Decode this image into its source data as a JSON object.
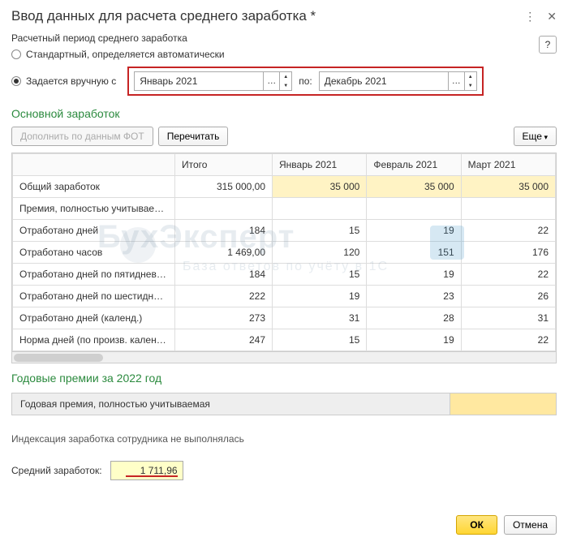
{
  "window": {
    "title": "Ввод данных для расчета среднего заработка *"
  },
  "period": {
    "section_label": "Расчетный период среднего заработка",
    "radio_auto": "Стандартный, определяется автоматически",
    "radio_manual": "Задается вручную  с",
    "from": "Январь 2021",
    "to_label": "по:",
    "to": "Декабрь 2021"
  },
  "earnings": {
    "heading": "Основной заработок",
    "btn_add": "Дополнить по данным ФОТ",
    "btn_recalc": "Перечитать",
    "btn_more": "Еще"
  },
  "table": {
    "headers": [
      "",
      "Итого",
      "Январь 2021",
      "Февраль 2021",
      "Март 2021"
    ],
    "rows": [
      {
        "label": "Общий заработок",
        "total": "315 000,00",
        "m1": "35 000",
        "m2": "35 000",
        "m3": "35 000",
        "yellow": true
      },
      {
        "label": "Премия, полностью учитываемая",
        "total": "",
        "m1": "",
        "m2": "",
        "m3": ""
      },
      {
        "label": "Отработано дней",
        "total": "184",
        "m1": "15",
        "m2": "19",
        "m3": "22"
      },
      {
        "label": "Отработано часов",
        "total": "1 469,00",
        "m1": "120",
        "m2": "151",
        "m3": "176"
      },
      {
        "label": "Отработано дней по пятидневной ...",
        "total": "184",
        "m1": "15",
        "m2": "19",
        "m3": "22"
      },
      {
        "label": "Отработано дней по шестидневно...",
        "total": "222",
        "m1": "19",
        "m2": "23",
        "m3": "26"
      },
      {
        "label": "Отработано дней (календ.)",
        "total": "273",
        "m1": "31",
        "m2": "28",
        "m3": "31"
      },
      {
        "label": "Норма дней (по произв. календар...",
        "total": "247",
        "m1": "15",
        "m2": "19",
        "m3": "22"
      }
    ]
  },
  "annual": {
    "heading": "Годовые премии за 2022 год",
    "row_label": "Годовая премия, полностью учитываемая"
  },
  "indexation_note": "Индексация заработка сотрудника не выполнялась",
  "average": {
    "label": "Средний заработок:",
    "value": "1 711,96"
  },
  "footer": {
    "ok": "ОК",
    "cancel": "Отмена"
  },
  "watermark": {
    "main": "БухЭксперт",
    "sub": "База ответов по учёту в 1С"
  }
}
